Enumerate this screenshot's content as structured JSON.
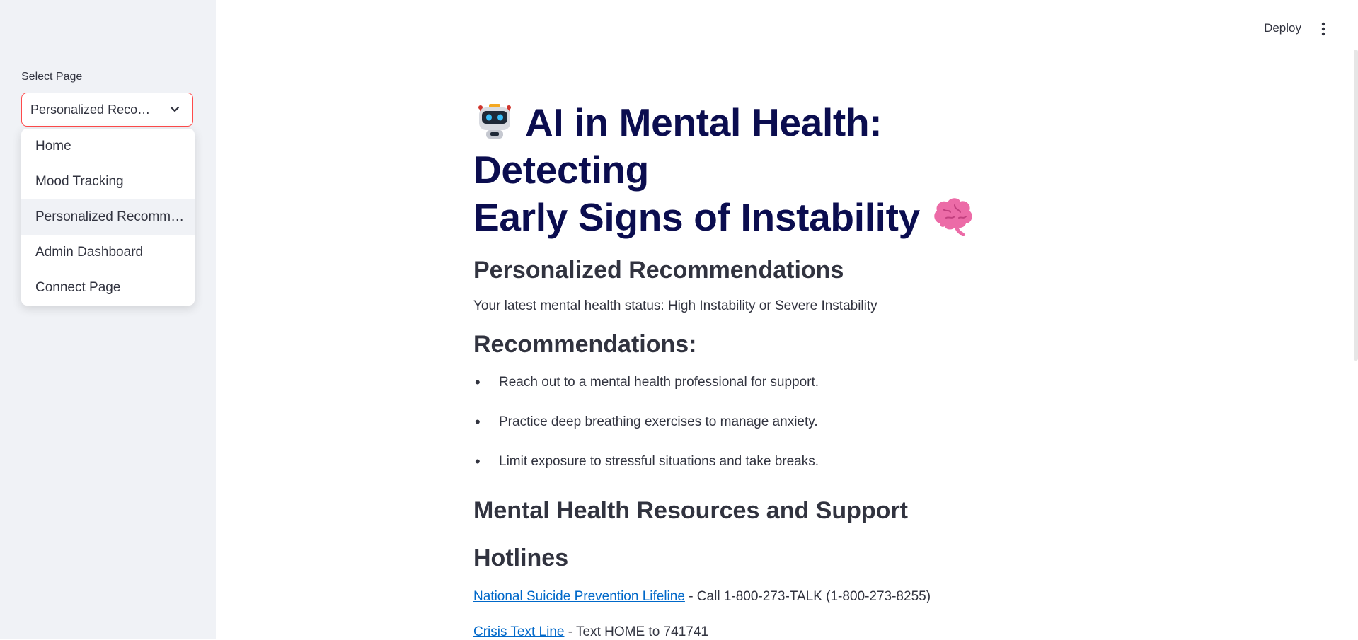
{
  "sidebar": {
    "select_label": "Select Page",
    "selected_value": "Personalized Reco…",
    "options": [
      {
        "label": "Home"
      },
      {
        "label": "Mood Tracking"
      },
      {
        "label": "Personalized Recomm…"
      },
      {
        "label": "Admin Dashboard"
      },
      {
        "label": "Connect Page"
      }
    ]
  },
  "topbar": {
    "deploy_label": "Deploy"
  },
  "main": {
    "title_line1": "AI in Mental Health: Detecting",
    "title_line2": "Early Signs of Instability",
    "section_title": "Personalized Recommendations",
    "status_text": "Your latest mental health status: High Instability or Severe Instability",
    "recs_title": "Recommendations:",
    "recommendations": [
      "Reach out to a mental health professional for support.",
      "Practice deep breathing exercises to manage anxiety.",
      "Limit exposure to stressful situations and take breaks."
    ],
    "resources_title": "Mental Health Resources and Support",
    "hotlines_title": "Hotlines",
    "hotlines": [
      {
        "link": "National Suicide Prevention Lifeline",
        "text": " - Call 1-800-273-TALK (1-800-273-8255)"
      },
      {
        "link": "Crisis Text Line",
        "text": " - Text HOME to 741741"
      }
    ]
  },
  "colors": {
    "accent": "#ff4b4b",
    "title": "#0b0d4f",
    "link": "#0068c9",
    "sidebar_bg": "#f0f2f6"
  },
  "icons": [
    "chevron-down-icon",
    "kebab-menu-icon",
    "robot-icon",
    "brain-icon"
  ]
}
